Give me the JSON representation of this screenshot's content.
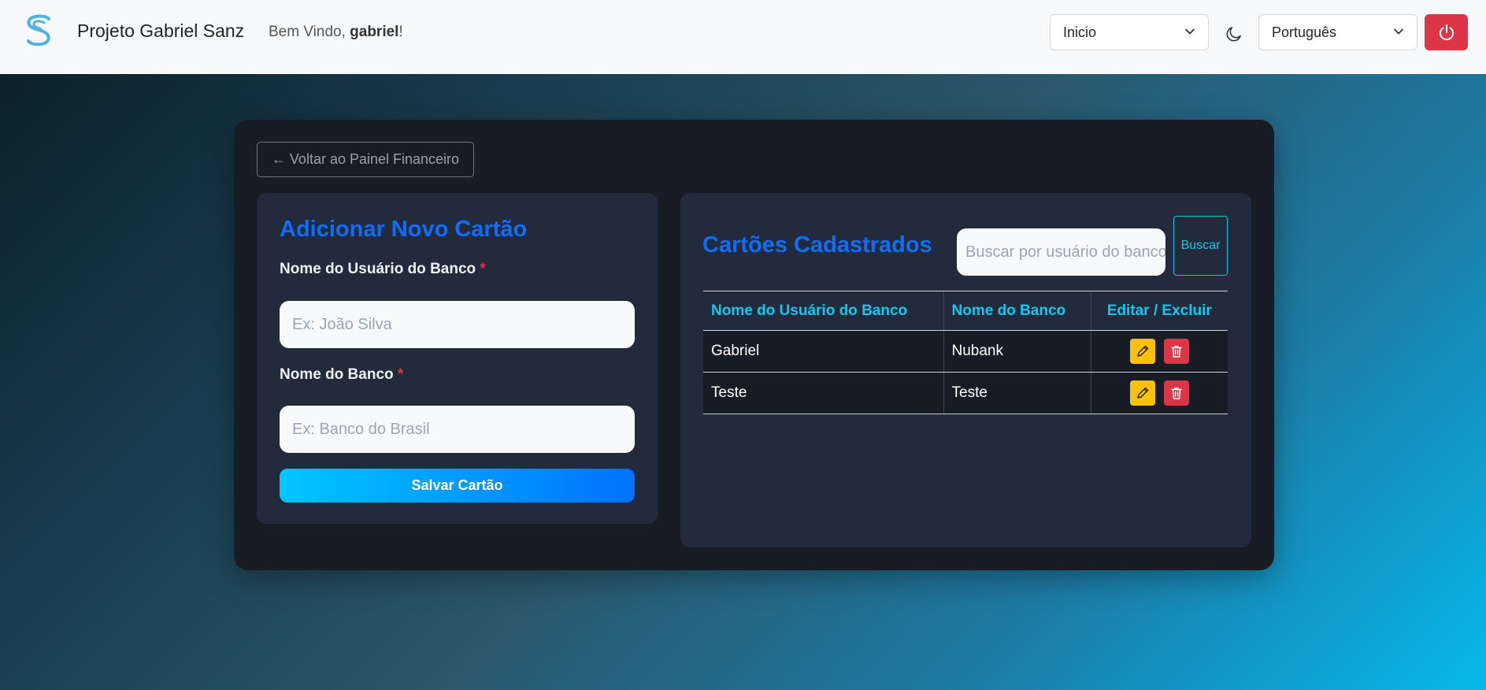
{
  "header": {
    "brand": "Projeto Gabriel Sanz",
    "welcome_prefix": "Bem Vindo, ",
    "welcome_user": "gabriel",
    "welcome_suffix": "!",
    "page_select": "Inicio",
    "language_select": "Português",
    "icons": [
      "logo-s-icon",
      "chevron-down-icon",
      "moon-icon",
      "power-icon"
    ]
  },
  "back_button": "← Voltar ao Painel Financeiro",
  "form": {
    "title": "Adicionar Novo Cartão",
    "user_label": "Nome do Usuário do Banco",
    "user_placeholder": "Ex: João Silva",
    "bank_label": "Nome do Banco",
    "bank_placeholder": "Ex: Banco do Brasil",
    "required_mark": "*",
    "save_label": "Salvar Cartão"
  },
  "list": {
    "title": "Cartões Cadastrados",
    "search_placeholder": "Buscar por usuário do banco",
    "search_label": "Buscar",
    "columns": [
      "Nome do Usuário do Banco",
      "Nome do Banco",
      "Editar / Excluir"
    ],
    "rows": [
      {
        "user": "Gabriel",
        "bank": "Nubank"
      },
      {
        "user": "Teste",
        "bank": "Teste"
      }
    ]
  },
  "colors": {
    "accent_blue": "#0d6efd",
    "accent_cyan": "#0dcaf0",
    "danger": "#dc3545",
    "warning": "#ffc107"
  }
}
